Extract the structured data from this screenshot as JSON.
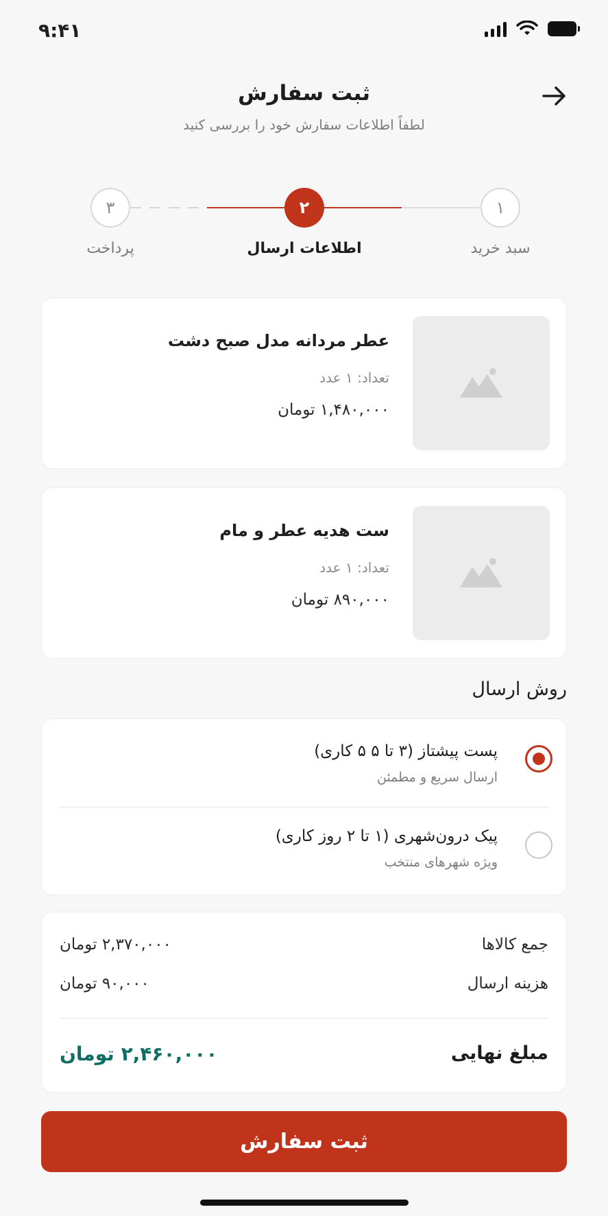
{
  "status_bar": {
    "time": "۹:۴۱"
  },
  "header": {
    "title": "ثبت سفارش",
    "subtitle": "لطفاً اطلاعات سفارش خود را بررسی کنید"
  },
  "stepper": {
    "steps": [
      {
        "number": "۱",
        "label": "سبد خرید",
        "state": "done"
      },
      {
        "number": "۲",
        "label": "اطلاعات ارسال",
        "state": "active"
      },
      {
        "number": "۳",
        "label": "پرداخت",
        "state": "upcoming"
      }
    ]
  },
  "products": [
    {
      "name": "عطر مردانه مدل صبح دشت",
      "quantity": "تعداد: ۱ عدد",
      "price": "۱,۴۸۰,۰۰۰ تومان"
    },
    {
      "name": "ست هدیه عطر و مام",
      "quantity": "تعداد: ۱ عدد",
      "price": "۸۹۰,۰۰۰ تومان"
    }
  ],
  "shipping": {
    "title": "روش ارسال",
    "options": [
      {
        "name": "پست پیشتاز (۳ تا ۵ ۵ کاری)",
        "description": "ارسال سریع و مطمئن",
        "selected": true
      },
      {
        "name": "پیک درون‌شهری (۱ تا ۲ روز کاری)",
        "description": "ویژه شهرهای منتخب",
        "selected": false
      }
    ]
  },
  "summary": {
    "items_label": "جمع کالاها",
    "items_value": "۲,۳۷۰,۰۰۰ تومان",
    "shipping_label": "هزینه ارسال",
    "shipping_value": "۹۰,۰۰۰ تومان",
    "total_label": "مبلغ نهایی",
    "total_value": "۲,۴۶۰,۰۰۰ تومان"
  },
  "submit_label": "ثبت سفارش",
  "colors": {
    "accent": "#c0341b",
    "total": "#0f6d63",
    "background": "#f7f7f7"
  }
}
